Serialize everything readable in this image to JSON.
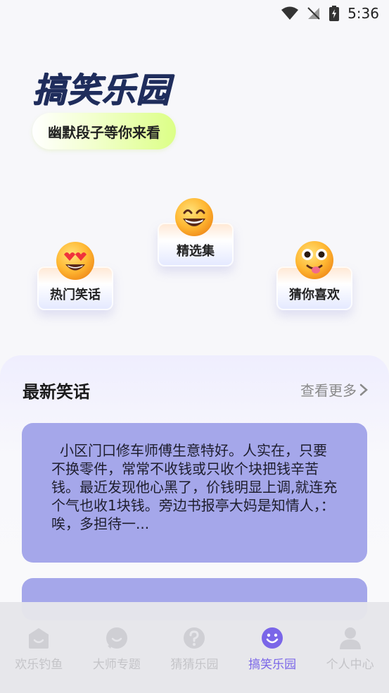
{
  "status": {
    "time": "5:36"
  },
  "header": {
    "title": "搞笑乐园",
    "subtitle": "幽默段子等你来看"
  },
  "categories": [
    {
      "label": "热门笑话",
      "icon": "heart-eyes-emoji-icon"
    },
    {
      "label": "精选集",
      "icon": "grin-emoji-icon"
    },
    {
      "label": "猜你喜欢",
      "icon": "goofy-emoji-icon"
    }
  ],
  "latest": {
    "title": "最新笑话",
    "more": "查看更多",
    "jokes": [
      {
        "text": "小区门口修车师傅生意特好。人实在，只要不换零件，常常不收钱或只收个块把钱辛苦钱。最近发现他心黑了，价钱明显上调,就连充个气也收1块钱。旁边书报亭大妈是知情人，：唉，多担待一..."
      },
      {
        "text": ""
      }
    ]
  },
  "nav": {
    "items": [
      {
        "label": "欢乐钓鱼",
        "icon": "fishing-icon"
      },
      {
        "label": "大师专题",
        "icon": "master-icon"
      },
      {
        "label": "猜猜乐园",
        "icon": "question-icon"
      },
      {
        "label": "搞笑乐园",
        "icon": "smile-icon",
        "active": true
      },
      {
        "label": "个人中心",
        "icon": "person-icon"
      }
    ]
  },
  "colors": {
    "accent": "#7a66e8",
    "card": "#a5a7ea",
    "title": "#1f2d5c"
  }
}
